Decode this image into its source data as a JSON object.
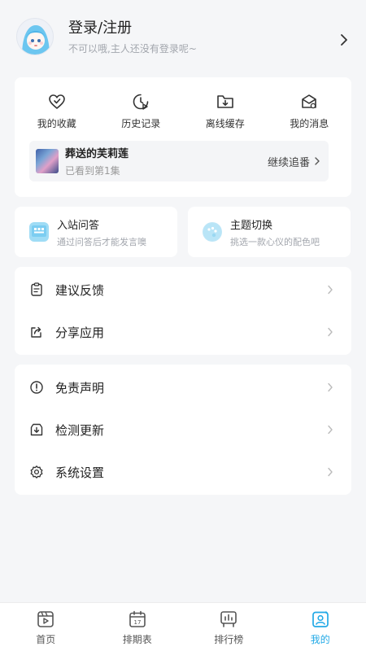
{
  "profile": {
    "title": "登录/注册",
    "subtitle": "不可以哦,主人还没有登录呢~"
  },
  "quick_actions": [
    {
      "label": "我的收藏",
      "icon": "heart-icon"
    },
    {
      "label": "历史记录",
      "icon": "history-icon"
    },
    {
      "label": "离线缓存",
      "icon": "folder-download-icon"
    },
    {
      "label": "我的消息",
      "icon": "mail-icon"
    }
  ],
  "resume": {
    "title": "葬送的芙莉莲",
    "progress": "已看到第1集",
    "action": "继续追番"
  },
  "cards": {
    "qa": {
      "title": "入站问答",
      "subtitle": "通过问答后才能发言噢"
    },
    "theme": {
      "title": "主题切换",
      "subtitle": "挑选一款心仪的配色吧"
    }
  },
  "menu_group1": [
    {
      "label": "建议反馈",
      "icon": "feedback-icon"
    },
    {
      "label": "分享应用",
      "icon": "share-icon"
    }
  ],
  "menu_group2": [
    {
      "label": "免责声明",
      "icon": "alert-circle-icon"
    },
    {
      "label": "检测更新",
      "icon": "download-box-icon"
    },
    {
      "label": "系统设置",
      "icon": "gear-icon"
    }
  ],
  "tabs": [
    {
      "label": "首页",
      "icon": "home-video-icon"
    },
    {
      "label": "排期表",
      "icon": "calendar-icon",
      "badge": "17"
    },
    {
      "label": "排行榜",
      "icon": "ranking-icon"
    },
    {
      "label": "我的",
      "icon": "profile-icon",
      "active": true
    }
  ],
  "colors": {
    "accent": "#22a9e6",
    "background": "#f5f6f8"
  }
}
